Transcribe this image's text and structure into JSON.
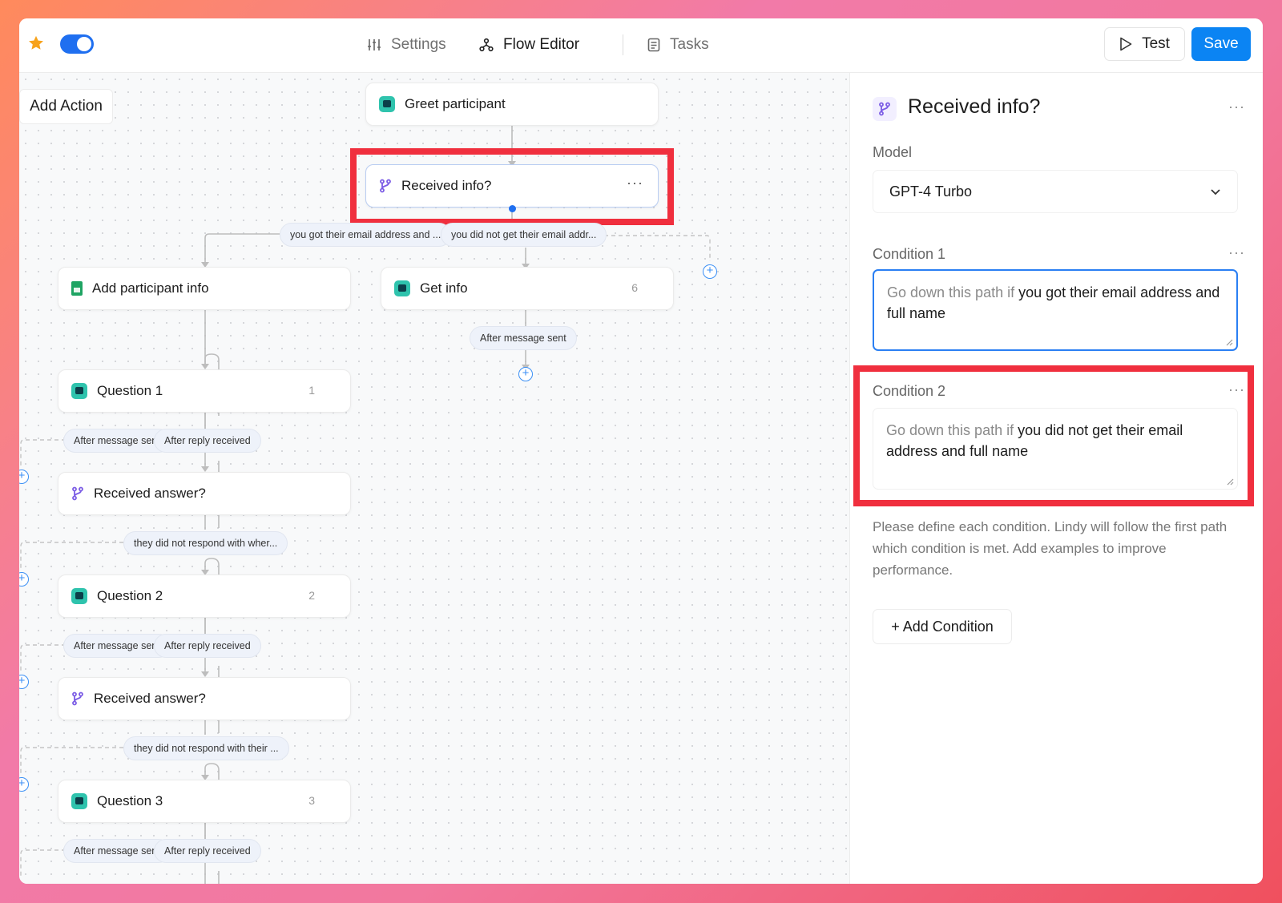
{
  "header": {
    "tabs": [
      {
        "label": "Settings",
        "icon": "sliders-icon"
      },
      {
        "label": "Flow Editor",
        "icon": "flow-icon"
      },
      {
        "label": "Tasks",
        "icon": "document-icon"
      }
    ],
    "test_label": "Test",
    "save_label": "Save",
    "toggle_on": true
  },
  "canvas": {
    "add_action_label": "Add Action",
    "nodes": {
      "greet": {
        "label": "Greet participant"
      },
      "received_info": {
        "label": "Received info?",
        "menu": "···"
      },
      "add_participant_info": {
        "label": "Add participant info"
      },
      "get_info": {
        "label": "Get info",
        "count": "6"
      },
      "question1": {
        "label": "Question 1",
        "count": "1"
      },
      "received_answer1": {
        "label": "Received answer?"
      },
      "question2": {
        "label": "Question 2",
        "count": "2"
      },
      "received_answer2": {
        "label": "Received answer?"
      },
      "question3": {
        "label": "Question 3",
        "count": "3"
      }
    },
    "pills": {
      "path_yes": "you got their email address and ...",
      "path_no": "you did not get their email addr...",
      "getinfo_after_sent": "After message sent",
      "q1_after_sent": "After message sent",
      "q1_after_reply": "After reply received",
      "ra1_no": "they did not respond with wher...",
      "q2_after_sent": "After message sent",
      "q2_after_reply": "After reply received",
      "ra2_no": "they did not respond with their ...",
      "q3_after_sent": "After message sent",
      "q3_after_reply": "After reply received"
    },
    "plus_symbol": "+"
  },
  "panel": {
    "title": "Received info?",
    "menu": "···",
    "model_label": "Model",
    "model_value": "GPT-4 Turbo",
    "condition1": {
      "label": "Condition 1",
      "prefix": "Go down this path if",
      "text": "you got their email address and full name"
    },
    "condition2": {
      "label": "Condition 2",
      "prefix": "Go down this path if",
      "text": "you did not get their email address and full name"
    },
    "help_text": "Please define each condition. Lindy will follow the first path which condition is met. Add examples to improve performance.",
    "add_condition_label": "+ Add Condition"
  },
  "colors": {
    "accent": "#0b84f3",
    "highlight_red": "#f02f3e",
    "star": "#f7a21b"
  }
}
